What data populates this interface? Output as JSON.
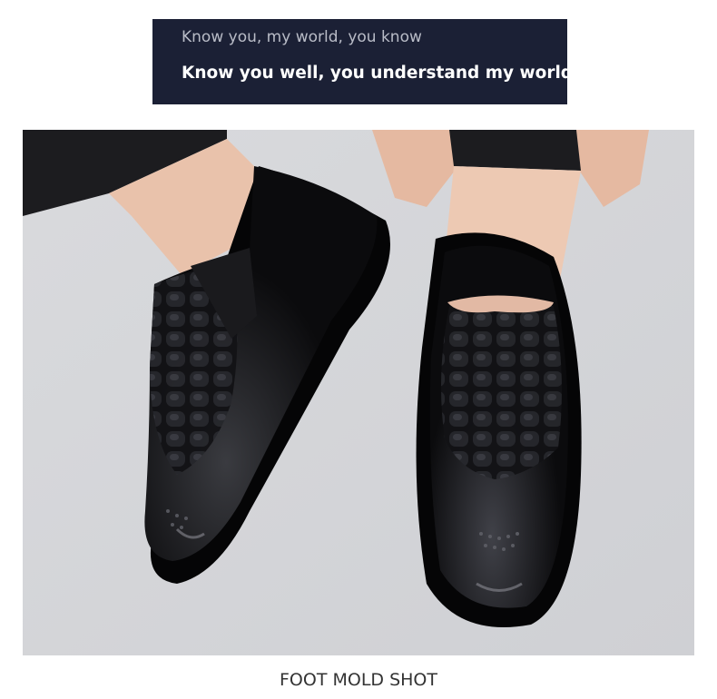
{
  "banner": {
    "subtitle": "Know you, my world, you know",
    "title": "Know you well, you understand my world."
  },
  "caption": "FOOT MOLD SHOT",
  "colors": {
    "banner_bg": "#1b2035",
    "photo_bg": "#d4d5d9",
    "shoe": "#0d0d0f"
  }
}
